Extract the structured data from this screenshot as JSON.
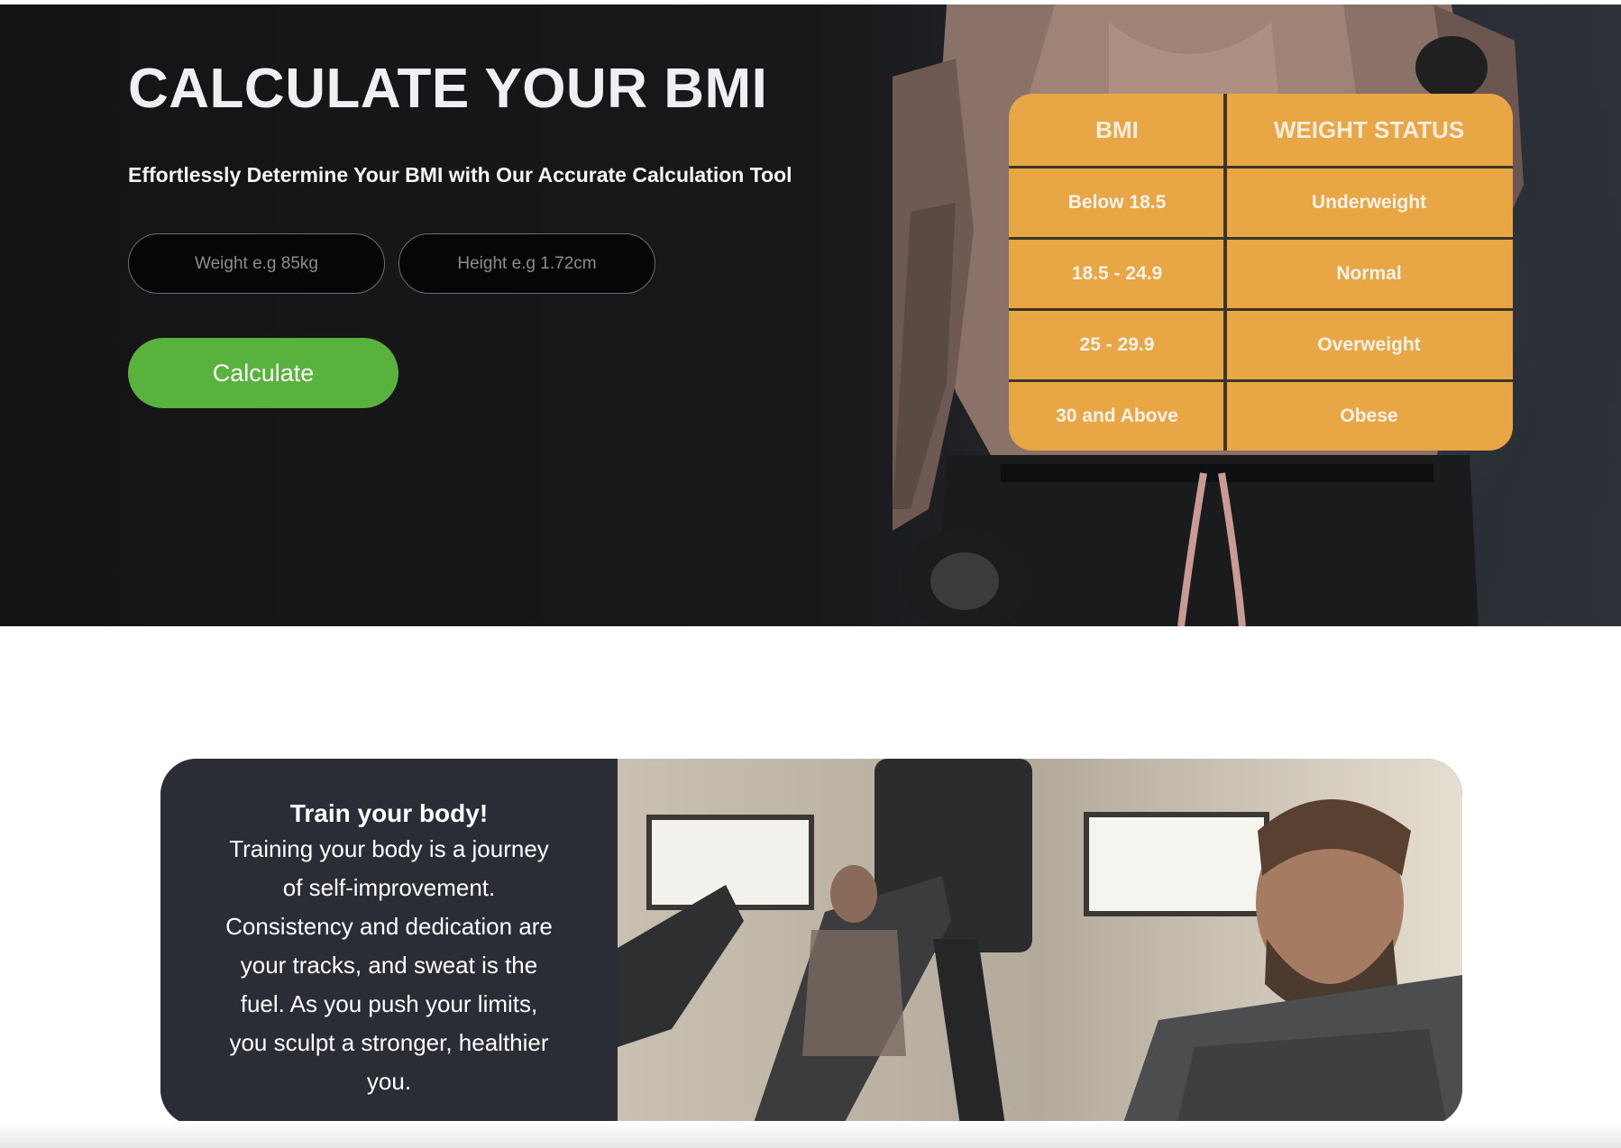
{
  "hero": {
    "title": "CALCULATE YOUR BMI",
    "subtitle": "Effortlessly Determine Your BMI with Our Accurate Calculation Tool",
    "weight_placeholder": "Weight e.g 85kg",
    "height_placeholder": "Height e.g 1.72cm",
    "calculate_label": "Calculate",
    "image": "muscular-man-with-dumbbells"
  },
  "bmi_table": {
    "headers": [
      "BMI",
      "WEIGHT STATUS"
    ],
    "rows": [
      [
        "Below 18.5",
        "Underweight"
      ],
      [
        "18.5 - 24.9",
        "Normal"
      ],
      [
        "25 - 29.9",
        "Overweight"
      ],
      [
        "30 and Above",
        "Obese"
      ]
    ]
  },
  "train": {
    "title": "Train your body!",
    "body": "Training your body is a journey of self-improvement. Consistency and dedication are your tracks, and sweat is the fuel. As you push your limits, you sculpt a stronger, healthier you.",
    "image": "gym-rowing-machine-photo"
  },
  "colors": {
    "hero_bg": "#161618",
    "accent_green": "#58b23d",
    "table_orange": "#e8a645",
    "card_dark": "#2a2d35"
  }
}
